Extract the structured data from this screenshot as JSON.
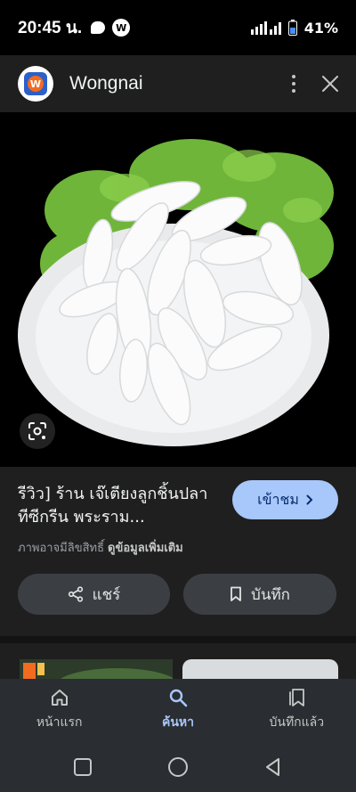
{
  "status_bar": {
    "time": "20:45 น.",
    "battery": "41%"
  },
  "header": {
    "title": "Wongnai",
    "logo_letter": "W",
    "more_icon": "more-vert-icon",
    "close_icon": "close-icon"
  },
  "result": {
    "title": "รีวิว] ร้าน เจ๊เตียงลูกชิ้นปลา ทีซีกรีน พระราม...",
    "visit_label": "เข้าชม",
    "copyright_text": "ภาพอาจมีลิขสิทธิ์",
    "more_info_label": "ดูข้อมูลเพิ่มเติม",
    "share_label": "แชร์",
    "save_label": "บันทึก"
  },
  "bottom_nav": {
    "items": [
      {
        "label": "หน้าแรก",
        "icon": "home-icon",
        "active": false
      },
      {
        "label": "ค้นหา",
        "icon": "search-icon",
        "active": true
      },
      {
        "label": "บันทึกแล้ว",
        "icon": "saved-icon",
        "active": false
      }
    ]
  },
  "colors": {
    "accent": "#a8c7fa",
    "panel": "#1f1f1f",
    "nav_bg": "#2a2d31"
  }
}
